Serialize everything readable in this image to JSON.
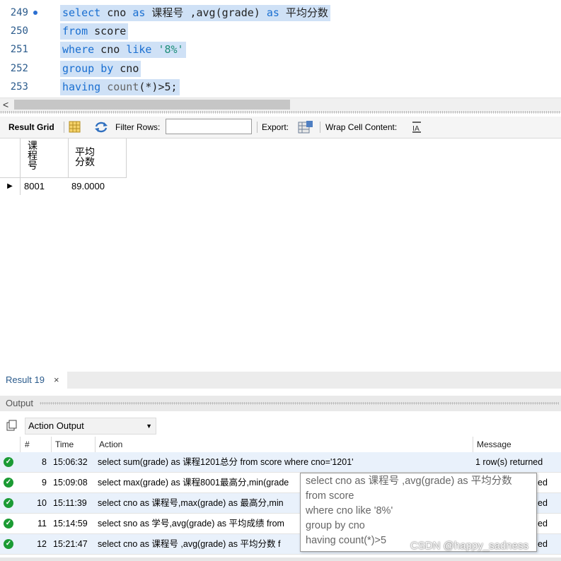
{
  "editor": {
    "lines": [
      {
        "num": "249",
        "tokens": [
          {
            "t": "select",
            "c": "kw"
          },
          {
            "t": " cno ",
            "c": ""
          },
          {
            "t": "as",
            "c": "kw"
          },
          {
            "t": " 课程号 ,",
            "c": ""
          },
          {
            "t": "avg",
            "c": ""
          },
          {
            "t": "(grade) ",
            "c": ""
          },
          {
            "t": "as",
            "c": "kw"
          },
          {
            "t": " 平均分数",
            "c": ""
          }
        ]
      },
      {
        "num": "250",
        "tokens": [
          {
            "t": "from",
            "c": "kw"
          },
          {
            "t": " score",
            "c": ""
          }
        ]
      },
      {
        "num": "251",
        "tokens": [
          {
            "t": "where",
            "c": "kw"
          },
          {
            "t": " cno ",
            "c": ""
          },
          {
            "t": "like",
            "c": "kw"
          },
          {
            "t": " ",
            "c": ""
          },
          {
            "t": "'8%'",
            "c": "str"
          }
        ]
      },
      {
        "num": "252",
        "tokens": [
          {
            "t": "group",
            "c": "kw"
          },
          {
            "t": " ",
            "c": ""
          },
          {
            "t": "by",
            "c": "kw"
          },
          {
            "t": " cno",
            "c": ""
          }
        ]
      },
      {
        "num": "253",
        "tokens": [
          {
            "t": "having",
            "c": "kw"
          },
          {
            "t": " ",
            "c": ""
          },
          {
            "t": "count",
            "c": "fn"
          },
          {
            "t": "(*)>5;",
            "c": ""
          }
        ]
      }
    ]
  },
  "scroll": {
    "left_arrow": "<"
  },
  "result_toolbar": {
    "result_grid": "Result Grid",
    "filter_rows": "Filter Rows:",
    "filter_value": "",
    "export": "Export:",
    "wrap": "Wrap Cell Content:"
  },
  "grid": {
    "headers": [
      "课\n程\n号",
      "平均\n分数"
    ],
    "rows": [
      [
        "8001",
        "89.0000"
      ]
    ]
  },
  "result_tab": {
    "label": "Result 19",
    "close": "×"
  },
  "output": {
    "title": "Output",
    "selector": "Action Output",
    "columns": [
      "#",
      "Time",
      "Action",
      "Message"
    ],
    "rows": [
      {
        "num": "8",
        "time": "15:06:32",
        "action": "select sum(grade) as 课程1201总分 from score where cno='1201'",
        "message": "1 row(s) returned"
      },
      {
        "num": "9",
        "time": "15:09:08",
        "action": "select max(grade) as 课程8001最高分,min(grade",
        "message": "ed"
      },
      {
        "num": "10",
        "time": "15:11:39",
        "action": "select cno as 课程号,max(grade) as 最高分,min",
        "message": "ed"
      },
      {
        "num": "11",
        "time": "15:14:59",
        "action": "select sno as 学号,avg(grade) as 平均成绩 from",
        "message": "ed"
      },
      {
        "num": "12",
        "time": "15:21:47",
        "action": "select cno as 课程号 ,avg(grade) as 平均分数 f",
        "message": "ed"
      }
    ]
  },
  "tooltip": {
    "lines": [
      "select cno as 课程号 ,avg(grade) as 平均分数",
      "from score",
      "where cno like '8%'",
      "group by cno",
      "having count(*)>5"
    ]
  },
  "watermark": "CSDN @happy_sadness",
  "colors": {
    "keyword": "#1a6fd1",
    "selection": "#cfe1f6",
    "ok": "#1b9b34",
    "line_number": "#2b5b8c"
  }
}
